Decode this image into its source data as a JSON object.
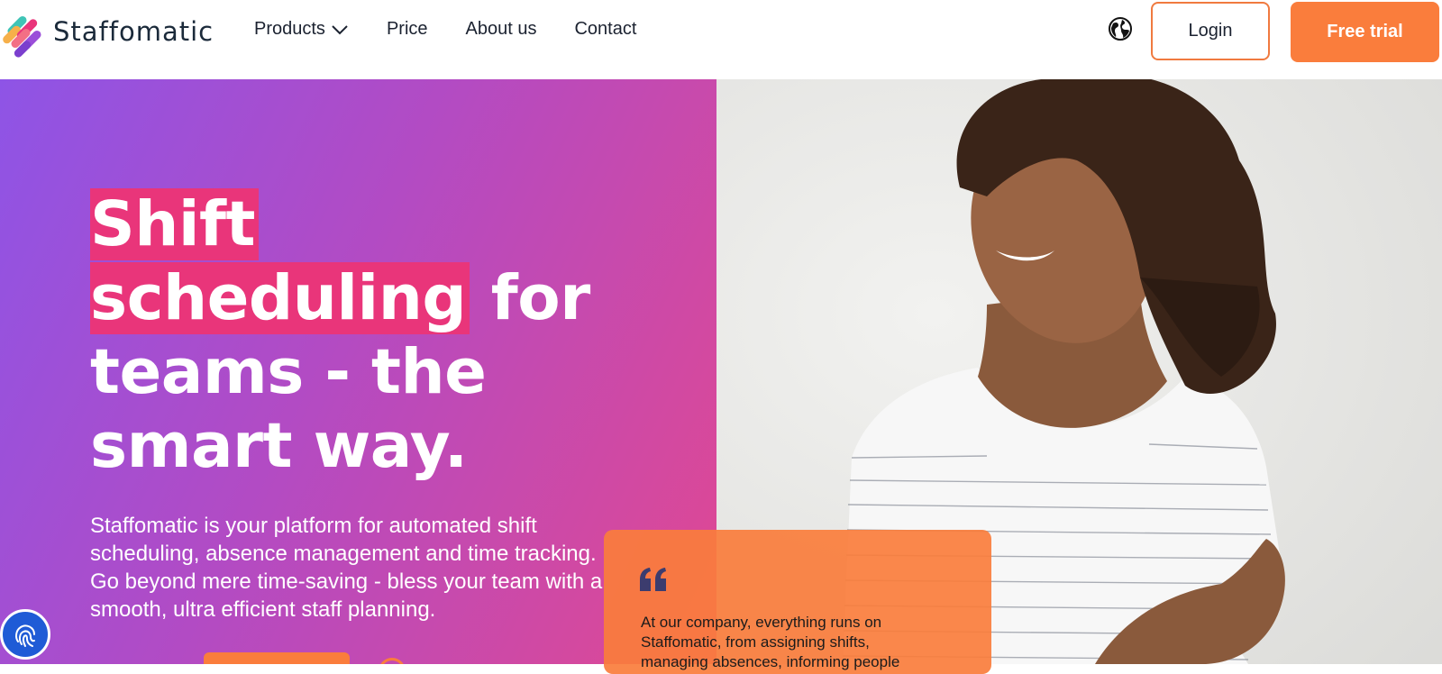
{
  "brand": {
    "name": "Staffomatic",
    "logo_icon": "staffomatic-logo-icon"
  },
  "nav": {
    "products_label": "Products",
    "price_label": "Price",
    "about_label": "About us",
    "contact_label": "Contact"
  },
  "header": {
    "language_icon": "globe-icon",
    "login_label": "Login",
    "trial_label": "Free trial"
  },
  "hero": {
    "headline_line1": "Shift",
    "headline_line2_highlight": "scheduling",
    "headline_line2_rest": "for",
    "headline_line3": "teams - the",
    "headline_line4": "smart way.",
    "description": "Staffomatic is your platform for automated shift scheduling, absence management and time tracking. Go beyond mere time-saving - bless your team with a smooth, ultra efficient staff planning."
  },
  "testimonial": {
    "text": "At our company, everything runs on Staffomatic, from assigning shifts, managing absences, informing people"
  },
  "colors": {
    "accent_orange": "#fa7d3c",
    "highlight_pink": "#e9357a",
    "gradient_start": "#8e54e6",
    "gradient_end": "#e04892"
  }
}
